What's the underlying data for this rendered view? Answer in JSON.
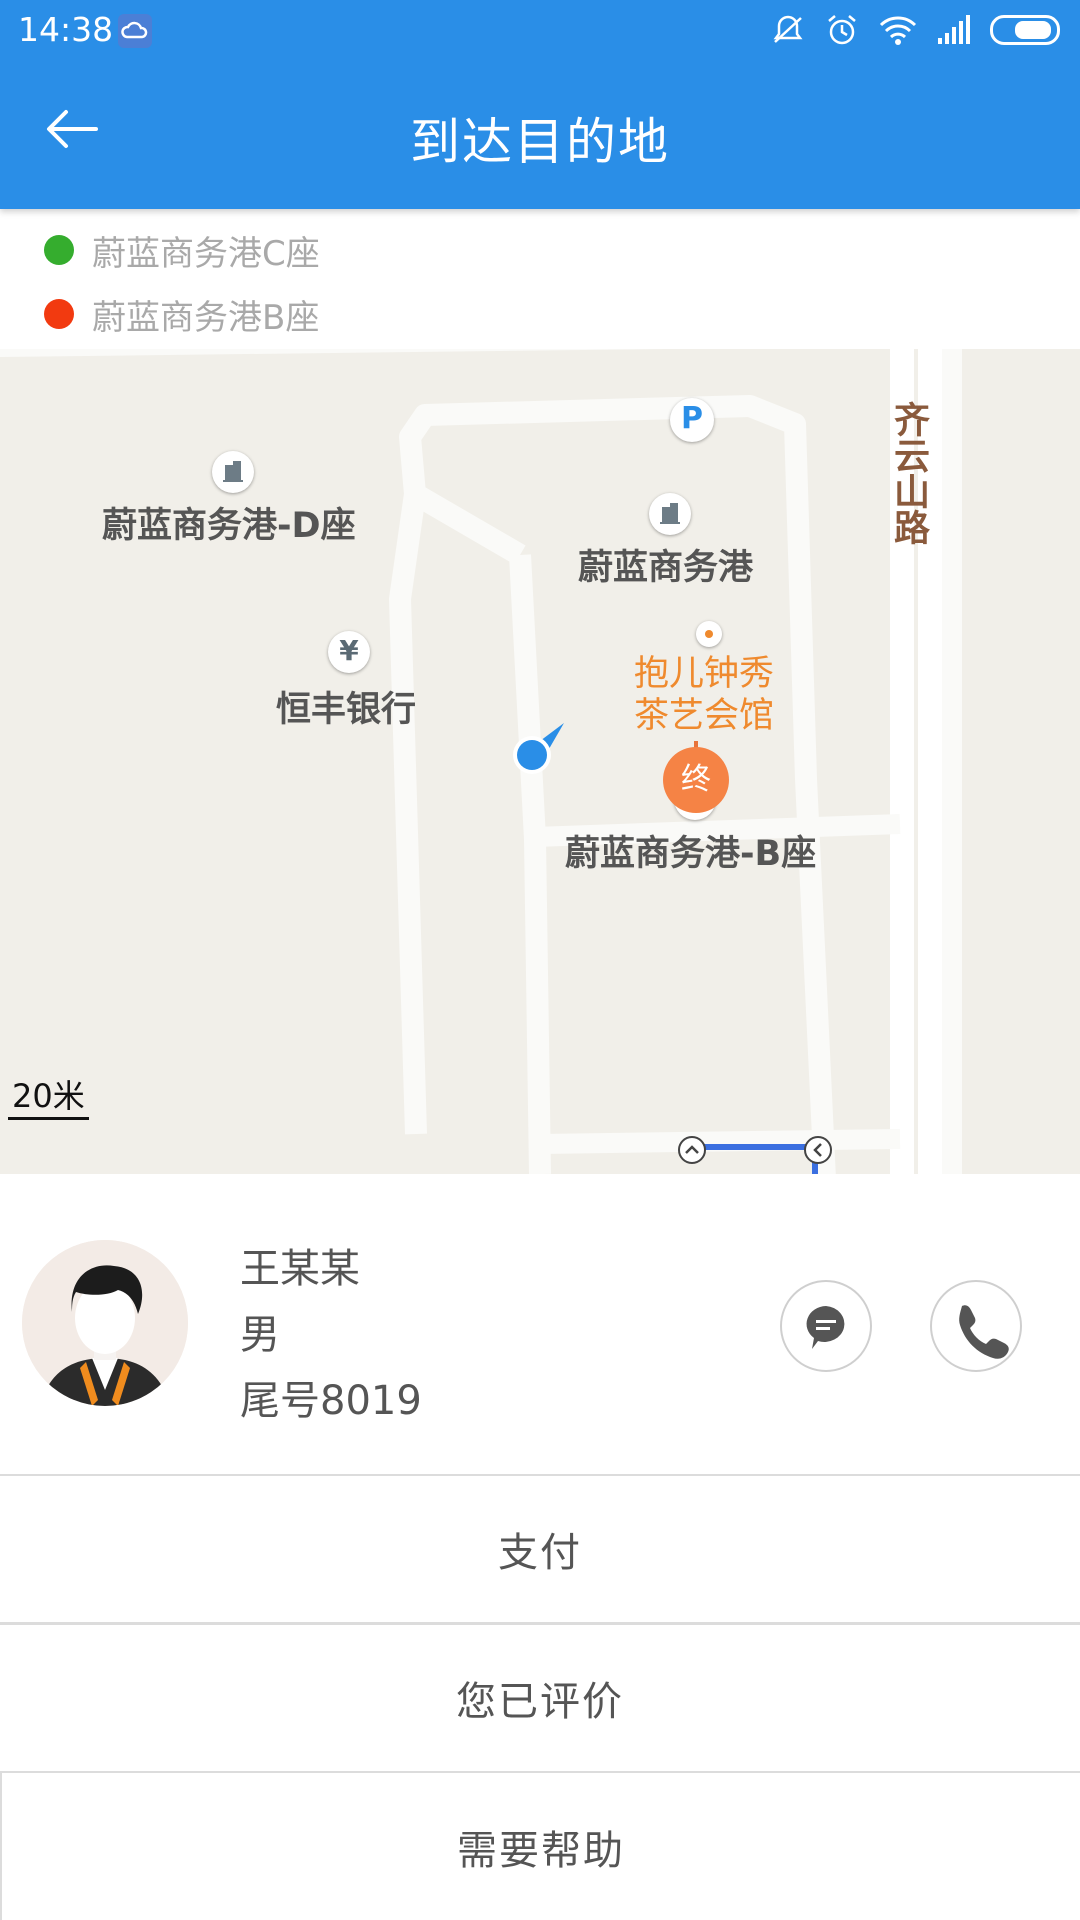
{
  "status_bar": {
    "time": "14:38"
  },
  "header": {
    "title": "到达目的地"
  },
  "route": {
    "start": {
      "label": "蔚蓝商务港C座",
      "color": "#35ad2e"
    },
    "end": {
      "label": "蔚蓝商务港B座",
      "color": "#f23a10"
    }
  },
  "map": {
    "pois": {
      "d_tower": "蔚蓝商务港-D座",
      "plaza": "蔚蓝商务港",
      "bank": "恒丰银行",
      "teahouse_line1": "抱儿钟秀",
      "teahouse_line2": "茶艺会馆",
      "b_tower": "蔚蓝商务港-B座"
    },
    "road": "齐云山路",
    "parking": "P",
    "bank_symbol": "¥",
    "end_marker": "终",
    "scale": "20米",
    "colors": {
      "accent": "#2a8ee7",
      "end_marker": "#f58345"
    }
  },
  "driver": {
    "name": "王某某",
    "gender": "男",
    "plate_tail": "尾号8019"
  },
  "actions": {
    "pay": "支付",
    "rated": "您已评价",
    "help": "需要帮助"
  }
}
